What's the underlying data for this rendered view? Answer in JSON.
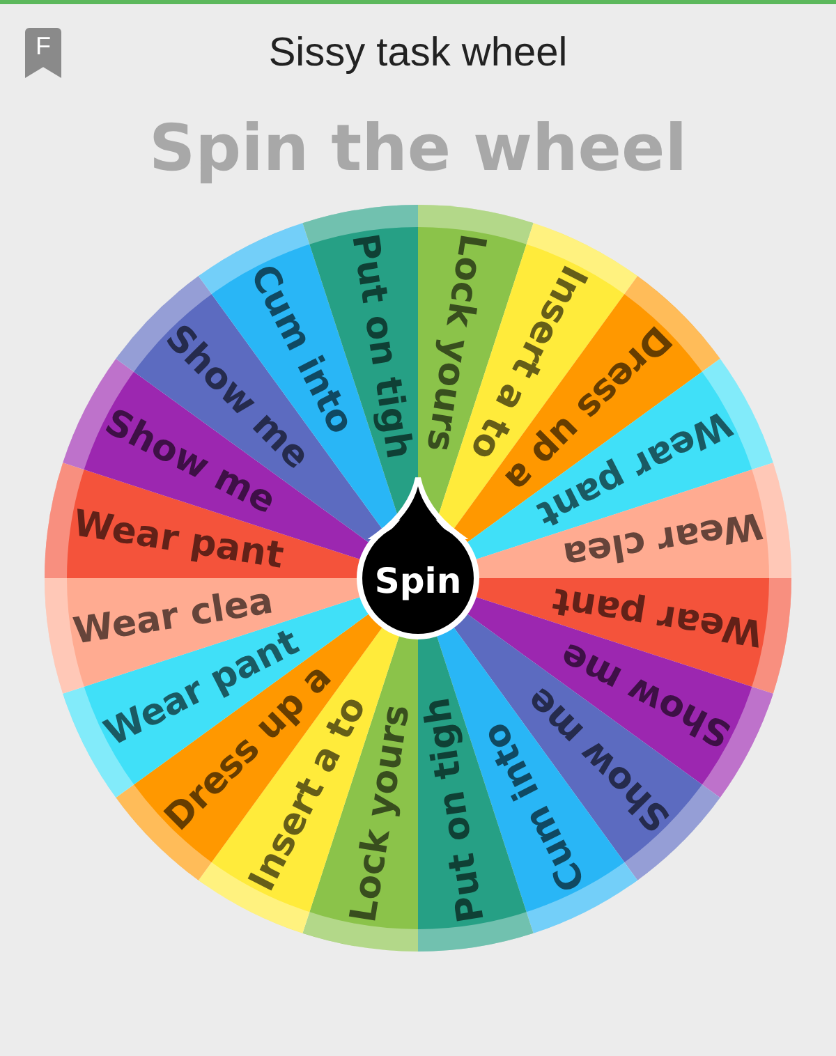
{
  "header": {
    "badge": "F",
    "title": "Sissy task wheel"
  },
  "heading": "Spin the wheel",
  "wheel": {
    "spin_button": "Spin",
    "segments": [
      {
        "label": "Lock yours",
        "color": "#8bc34a"
      },
      {
        "label": "Insert a to",
        "color": "#ffeb3b"
      },
      {
        "label": "Dress up a",
        "color": "#ff9800"
      },
      {
        "label": "Wear pant",
        "color": "#40e0f8"
      },
      {
        "label": "Wear clea",
        "color": "#ffab91"
      },
      {
        "label": "Wear pant",
        "color": "#f4533b"
      },
      {
        "label": "Show me",
        "color": "#9c27b0"
      },
      {
        "label": "Show me",
        "color": "#5c6bc0"
      },
      {
        "label": "Cum into",
        "color": "#29b6f6"
      },
      {
        "label": "Put on tigh",
        "color": "#26a085"
      },
      {
        "label": "Lock yours",
        "color": "#8bc34a"
      },
      {
        "label": "Insert a to",
        "color": "#ffeb3b"
      },
      {
        "label": "Dress up a",
        "color": "#ff9800"
      },
      {
        "label": "Wear pant",
        "color": "#40e0f8"
      },
      {
        "label": "Wear clea",
        "color": "#ffab91"
      },
      {
        "label": "Wear pant",
        "color": "#f4533b"
      },
      {
        "label": "Show me",
        "color": "#9c27b0"
      },
      {
        "label": "Show me",
        "color": "#5c6bc0"
      },
      {
        "label": "Cum into",
        "color": "#29b6f6"
      },
      {
        "label": "Put on tigh",
        "color": "#26a085"
      }
    ]
  }
}
